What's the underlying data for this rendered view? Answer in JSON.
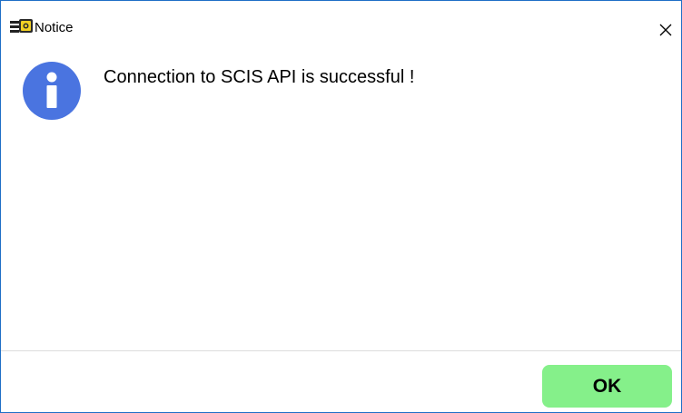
{
  "window": {
    "title": "Notice",
    "app_icon": "app-logo-icon",
    "close_icon": "close-icon"
  },
  "dialog": {
    "icon": "info-icon",
    "message": "Connection to SCIS API is successful !"
  },
  "footer": {
    "ok_label": "OK"
  },
  "colors": {
    "window_border": "#1f6fc6",
    "info_icon_bg": "#4a74e0",
    "ok_button_bg": "#85f08a",
    "divider": "#dcdcdc"
  }
}
